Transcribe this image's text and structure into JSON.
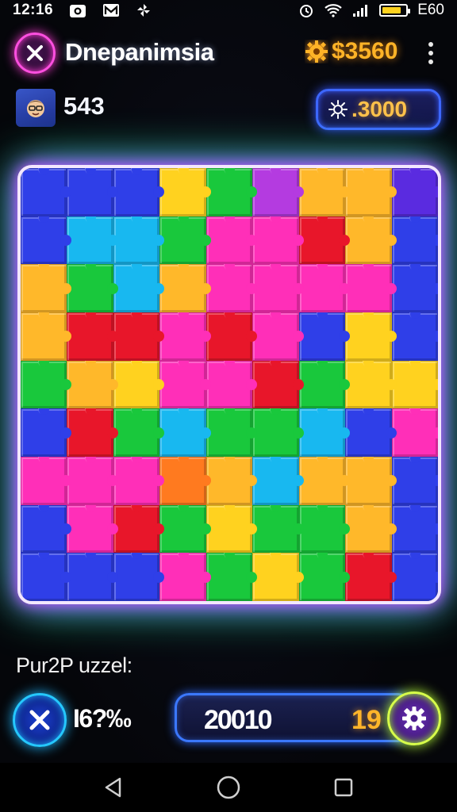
{
  "status_bar": {
    "time": "12:16",
    "battery_label": "E60",
    "battery_level_percent": 80,
    "icons": [
      "camera-icon",
      "gmail-icon",
      "pinwheel-icon",
      "alarm-icon",
      "wifi-icon",
      "signal-icon",
      "battery-icon"
    ]
  },
  "header": {
    "title": "Dnepanimsia",
    "coins": "$3560",
    "coin_icon": "gear-coin-icon"
  },
  "player": {
    "avatar_icon": "avatar-face-icon",
    "score": "543",
    "gems": ".3000",
    "gem_icon": "sparkle-icon"
  },
  "board": {
    "rows": 9,
    "cols": 9,
    "pieces": [
      "#2f3fe8",
      "#2f3fe8",
      "#2f3fe8",
      "#ffd21f",
      "#19c83c",
      "#b43be0",
      "#ffb82a",
      "#ffb82a",
      "#5a2be0",
      "#2f3fe8",
      "#18b8f0",
      "#18b8f0",
      "#19c83c",
      "#ff2fb8",
      "#ff2fb8",
      "#e8162a",
      "#ffb82a",
      "#2f3fe8",
      "#ffb82a",
      "#19c83c",
      "#18b8f0",
      "#ffb82a",
      "#ff2fb8",
      "#ff2fb8",
      "#ff2fb8",
      "#ff2fb8",
      "#2f3fe8",
      "#ffb82a",
      "#e8162a",
      "#e8162a",
      "#ff2fb8",
      "#e8162a",
      "#ff2fb8",
      "#2f3fe8",
      "#ffd21f",
      "#2f3fe8",
      "#19c83c",
      "#ffb82a",
      "#ffd21f",
      "#ff2fb8",
      "#ff2fb8",
      "#e8162a",
      "#19c83c",
      "#ffd21f",
      "#ffd21f",
      "#2f3fe8",
      "#e8162a",
      "#19c83c",
      "#18b8f0",
      "#19c83c",
      "#19c83c",
      "#18b8f0",
      "#2f3fe8",
      "#ff2fb8",
      "#ff2fb8",
      "#ff2fb8",
      "#ff2fb8",
      "#ff7a1f",
      "#ffb82a",
      "#18b8f0",
      "#ffb82a",
      "#ffb82a",
      "#2f3fe8",
      "#2f3fe8",
      "#ff2fb8",
      "#e8162a",
      "#19c83c",
      "#ffd21f",
      "#19c83c",
      "#19c83c",
      "#ffb82a",
      "#2f3fe8",
      "#2f3fe8",
      "#2f3fe8",
      "#2f3fe8",
      "#ff2fb8",
      "#19c83c",
      "#ffd21f",
      "#19c83c",
      "#e8162a",
      "#2f3fe8"
    ]
  },
  "footer": {
    "puzzle_label": "Pur2P uzzel:",
    "progress": "I6?‰",
    "points": "20010",
    "level": "19"
  },
  "nav": {
    "back_icon": "back-triangle-icon",
    "home_icon": "home-circle-icon",
    "recents_icon": "recents-square-icon"
  },
  "colors": {
    "accent_pink": "#ff4fe0",
    "accent_blue": "#3d67ff",
    "accent_gold": "#ffb327",
    "accent_lime": "#d7ff4a"
  }
}
